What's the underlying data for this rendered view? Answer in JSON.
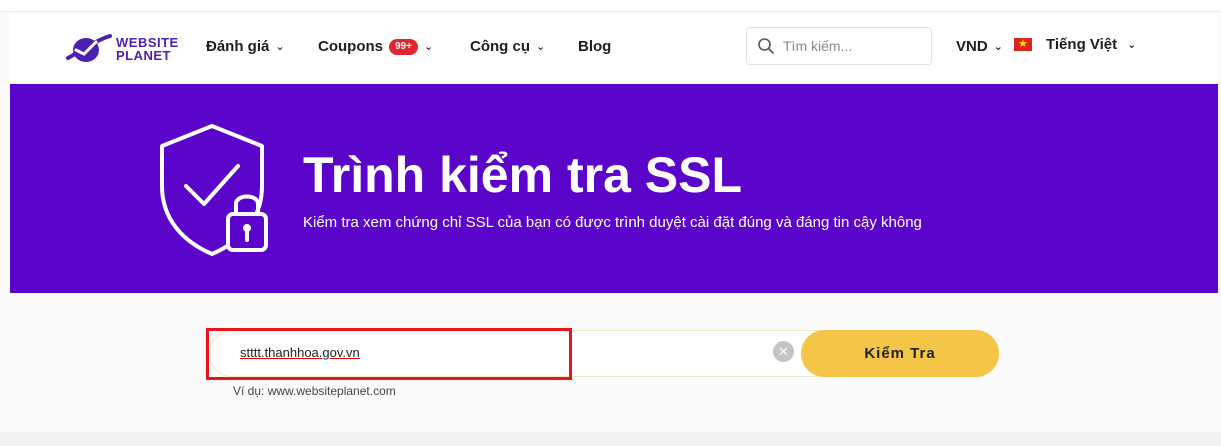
{
  "header": {
    "logo": {
      "line1": "WEBSITE",
      "line2": "PLANET"
    },
    "nav": {
      "danh_gia": "Đánh giá",
      "coupons": "Coupons",
      "coupons_badge": "99+",
      "cong_cu": "Công cụ",
      "blog": "Blog"
    },
    "search": {
      "placeholder": "Tìm kiếm..."
    },
    "currency": "VND",
    "language": "Tiếng Việt"
  },
  "hero": {
    "title": "Trình kiểm tra SSL",
    "subtitle": "Kiểm tra xem chứng chỉ SSL của bạn có được trình duyệt cài đặt đúng và đáng tin cậy không",
    "accent_color": "#5a05c9"
  },
  "form": {
    "value": "stttt.thanhhoa.gov.vn",
    "submit_label": "Kiểm Tra",
    "example": "Ví dụ: www.websiteplanet.com",
    "button_color": "#f5c547",
    "highlight_color": "#e8141b"
  },
  "icons": {
    "search": "search-icon",
    "shield": "shield-check-lock-icon",
    "clear": "clear-icon",
    "chevron": "chevron-down-icon",
    "flag": "vietnam-flag-icon"
  }
}
